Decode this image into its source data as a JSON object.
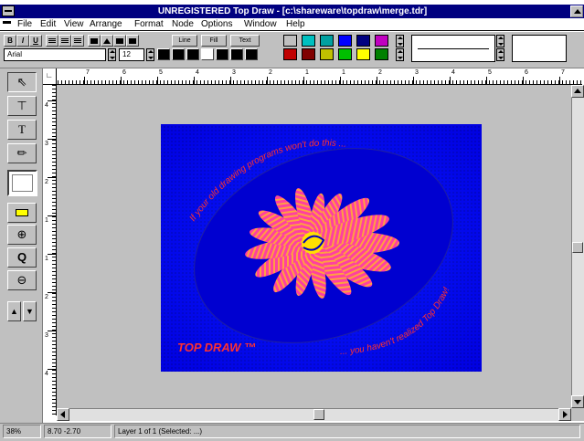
{
  "window": {
    "title": "UNREGISTERED Top Draw - [c:\\shareware\\topdraw\\merge.tdr]"
  },
  "menu": {
    "items": [
      "File",
      "Edit",
      "View",
      "Arrange",
      "Format",
      "Node",
      "Options",
      "Window",
      "Help"
    ]
  },
  "toolbar": {
    "text_buttons": [
      "Line",
      "Fill",
      "Text"
    ],
    "font_name": "Arial",
    "font_size": "12",
    "colors": [
      "#c0c0c0",
      "#00c0c0",
      "#00a0a0",
      "#0000ff",
      "#000080",
      "#c000c0",
      "#c00000",
      "#800000",
      "#c0c000",
      "#00c000",
      "#ffff00",
      "#008000"
    ]
  },
  "rulers": {
    "horizontal": [
      "7",
      "6",
      "5",
      "4",
      "3",
      "2",
      "1",
      "1",
      "2",
      "3",
      "4",
      "5",
      "6",
      "7"
    ],
    "vertical": [
      "4",
      "3",
      "2",
      "1",
      "1",
      "2",
      "3",
      "4"
    ]
  },
  "tools": [
    "arrow-tool",
    "node-tool",
    "text-tool",
    "pen-tool",
    "fill-tool",
    "ruler-tool",
    "zoom-in",
    "zoom-actual",
    "zoom-out",
    "layer-arrows"
  ],
  "drawing": {
    "top_text": "If your old drawing programs won't do this ...",
    "bottom_text": "... you haven't realized Top Draw!",
    "logo_text": "TOP DRAW ™"
  },
  "colors": {
    "workspace": "#c0c0c0",
    "canvas_blue": "#0000ff",
    "title_bar": "#000080"
  },
  "status": {
    "zoom": "38%",
    "coords": "8.70  -2.70",
    "layer": "Layer 1 of 1 (Selected: ...)"
  }
}
